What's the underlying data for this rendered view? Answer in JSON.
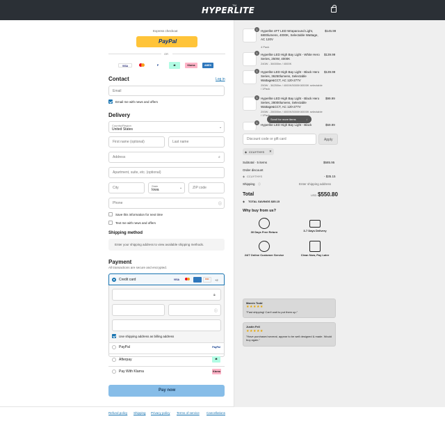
{
  "header": {
    "brand": "HYPERLITE",
    "brand_sup": "TM"
  },
  "express": {
    "title": "Express checkout",
    "paypal": "PayPal",
    "or": "OR"
  },
  "payment_logos": [
    "VISA",
    "MC",
    "P",
    "AP",
    "Klarna",
    "AMEX"
  ],
  "contact": {
    "title": "Contact",
    "login": "Log in",
    "email_placeholder": "Email",
    "news": "Email me with news and offers"
  },
  "delivery": {
    "title": "Delivery",
    "country_label": "Country/Region",
    "country_value": "United States",
    "first_name": "First name (optional)",
    "last_name": "Last name",
    "address": "Address",
    "apartment": "Apartment, suite, etc. (optional)",
    "city": "City",
    "state_label": "State",
    "state_value": "Iowa",
    "zip": "ZIP code",
    "phone": "Phone",
    "save_info": "Save this information for next time",
    "text_me": "Text me with news and offers"
  },
  "shipping_method": {
    "title": "Shipping method",
    "note": "Enter your shipping address to view available shipping methods."
  },
  "payment": {
    "title": "Payment",
    "subtitle": "All transactions are secure and encrypted.",
    "credit_card": "Credit card",
    "more_cards": "+2",
    "billing_same": "Use shipping address as billing address",
    "paypal": "PayPal",
    "afterpay": "Afterpay",
    "klarna": "Pay With Klarna",
    "pay_now": "Pay now"
  },
  "footer": {
    "links": [
      "Refund policy",
      "Shipping",
      "Privacy policy",
      "Terms of service",
      "Cancellations"
    ]
  },
  "cart": {
    "items": [
      {
        "qty": "1",
        "name": "Hyperlite 4FT LED Wraparound Light, 6800lumens, 4000K, Selectable Wattage, AC 120V",
        "variant": "4 Pack",
        "price": "$145.99"
      },
      {
        "qty": "1",
        "name": "Hyperlite LED High Bay Light - White Hero Series, 250W, 4000K",
        "variant": "240W - 36000lm / 4000K",
        "price": "$139.99"
      },
      {
        "qty": "1",
        "name": "Hyperlite LED High Bay Light - Black Hero Series, 36250lumens, Selectable Wattage&CCT, AC 120-277V",
        "variant": "250W - 36250lm / 4000K/5000K/6500K selectable / 1Pack",
        "price": "$139.99"
      },
      {
        "qty": "1",
        "name": "Hyperlite LED High Bay Light - Black Hero Series, 28000lumens, Selectable Wattage&CCT, AC 120-277V",
        "variant": "200W - 28000lm / 4000K/5000K/6500K selectable / 1Pack",
        "price": "$99.99"
      },
      {
        "qty": "1",
        "name": "Hyperlite LED High Bay Light - Black",
        "variant": "",
        "price": "$59.99"
      }
    ],
    "scroll_hint": "Scroll for more items",
    "discount_placeholder": "Discount code or gift card",
    "apply": "Apply",
    "code_tag": "CCUYTHYS",
    "subtotal_label": "Subtotal · 5 items",
    "subtotal": "$585.95",
    "order_discount": "Order discount",
    "code": "CCUYTHYS",
    "discount_value": "- $35.15",
    "shipping_label": "Shipping",
    "shipping_value": "Enter shipping address",
    "total_label": "Total",
    "currency": "USD",
    "total": "$550.80",
    "savings": "TOTAL SAVINGS  $35.15"
  },
  "why": {
    "title": "Why buy from us?",
    "items": [
      "30 Days Free Return",
      "3-7 Days Delivery",
      "24/7 Online Customer Service",
      "Clean Now, Pay Later"
    ]
  },
  "reviews": [
    {
      "name": "Marvin Todd",
      "stars": "★★★★★",
      "text": "\"Fast shipping! Can't wait to put them up.\""
    },
    {
      "name": "Justin Fell",
      "stars": "★★★★★",
      "text": "\"Have purchased several, appear to be well designed & made. Would buy again.\""
    }
  ],
  "colors": {
    "accent": "#1773b0",
    "paypal": "#ffc439",
    "pay_button": "#87bde8",
    "topbar": "#2b3036"
  }
}
